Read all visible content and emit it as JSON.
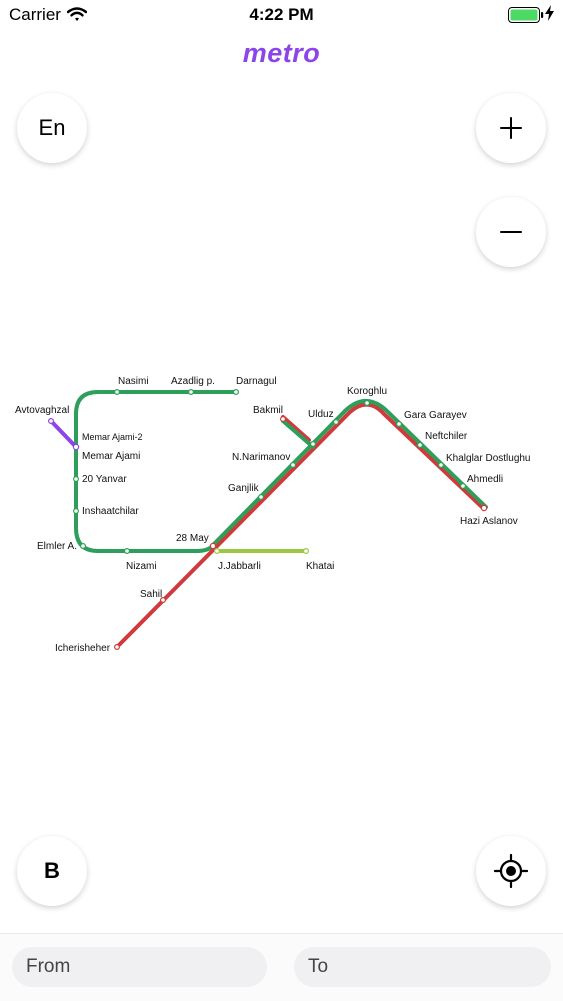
{
  "status_bar": {
    "carrier": "Carrier",
    "time": "4:22 PM"
  },
  "app": {
    "title": "metro"
  },
  "buttons": {
    "language": "En",
    "b_label": "B"
  },
  "icons": {
    "wifi": "wifi-icon",
    "battery": "battery-icon",
    "charging": "charging-bolt-icon",
    "zoom_in": "plus-icon",
    "zoom_out": "minus-icon",
    "locate": "crosshair-icon"
  },
  "colors": {
    "title": "#8B45E8",
    "red_line": "#D03A3A",
    "green_line": "#2E9E5B",
    "purple_line": "#8B45E8",
    "light_green_line": "#9CC743",
    "battery": "#4CD964"
  },
  "map": {
    "stations": {
      "nasimi": "Nasimi",
      "azadlig": "Azadlig p.",
      "darnagul": "Darnagul",
      "avtovaghzal": "Avtovaghzal",
      "memar_ajami_2": "Memar Ajami-2",
      "memar_ajami": "Memar Ajami",
      "yanvar": "20 Yanvar",
      "inshaatchilar": "Inshaatchilar",
      "elmler": "Elmler A.",
      "nizami": "Nizami",
      "may28": "28 May",
      "jabbarli": "J.Jabbarli",
      "khatai": "Khatai",
      "sahil": "Sahil",
      "icherisheher": "Icherisheher",
      "ganjlik": "Ganjlik",
      "narimanov": "N.Narimanov",
      "bakmil": "Bakmil",
      "ulduz": "Ulduz",
      "koroghlu": "Koroghlu",
      "gara_garayev": "Gara Garayev",
      "neftchiler": "Neftchiler",
      "khalglar": "Khalglar Dostlughu",
      "ahmedli": "Ahmedli",
      "hazi_aslanov": "Hazi Aslanov"
    }
  },
  "search": {
    "from_placeholder": "From",
    "to_placeholder": "To"
  }
}
